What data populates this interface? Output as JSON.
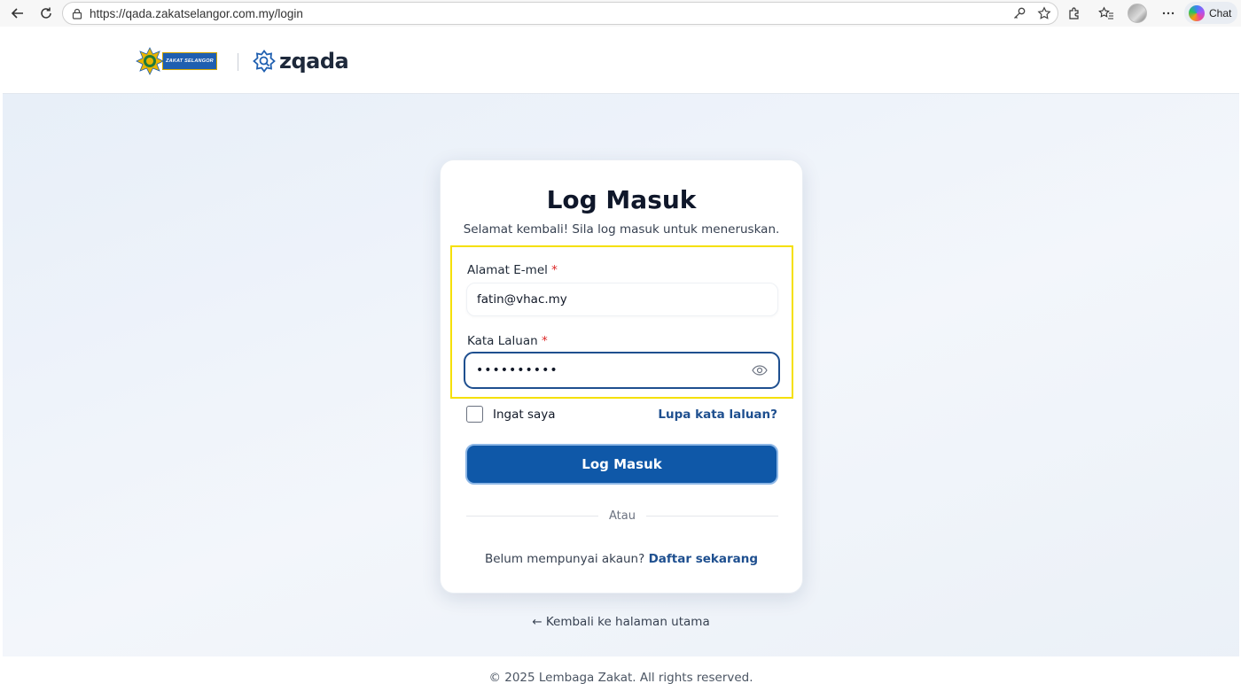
{
  "browser": {
    "url": "https://qada.zakatselangor.com.my/login",
    "chat_label": "Chat"
  },
  "header": {
    "brand_banner": "ZAKAT SELANGOR",
    "app_name": "zqada"
  },
  "login": {
    "title": "Log Masuk",
    "subtitle": "Selamat kembali! Sila log masuk untuk meneruskan.",
    "email_label": "Alamat E-mel",
    "email_value": "fatin@vhac.my",
    "password_label": "Kata Laluan",
    "password_value": "••••••••••",
    "required_mark": "*",
    "remember_label": "Ingat saya",
    "forgot_link": "Lupa kata laluan?",
    "submit_label": "Log Masuk",
    "divider_text": "Atau",
    "signup_prompt": "Belum mempunyai akaun?",
    "signup_link": "Daftar sekarang"
  },
  "back_link": "← Kembali ke halaman utama",
  "footer": {
    "copyright": "© 2025 Lembaga Zakat. All rights reserved."
  },
  "colors": {
    "primary": "#0f58a8",
    "link": "#1e4f8f",
    "highlight": "#f5e000",
    "required": "#dc2626"
  }
}
